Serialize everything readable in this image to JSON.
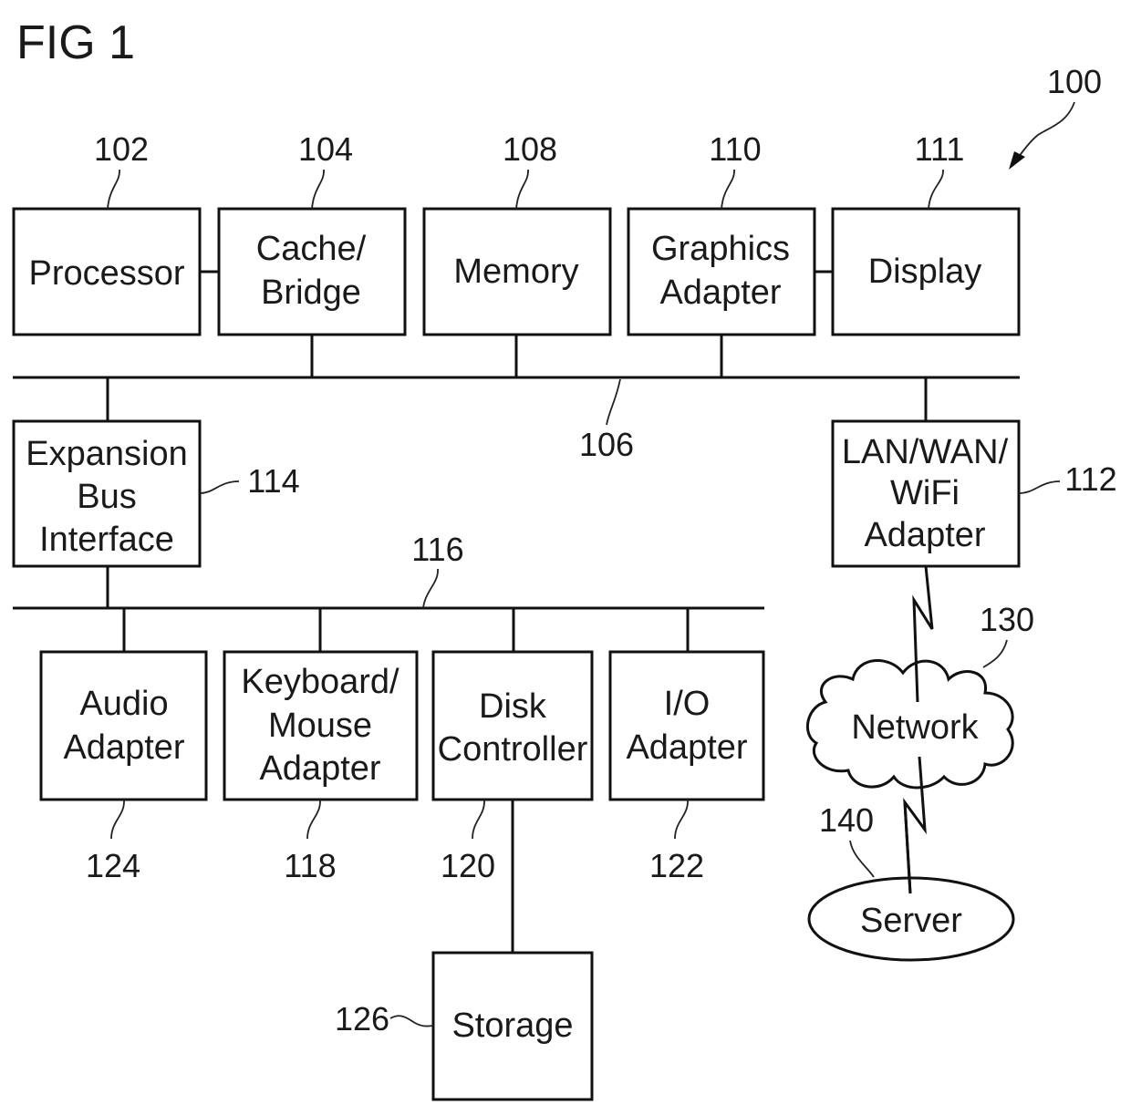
{
  "figure": {
    "title": "FIG 1",
    "system_ref": "100"
  },
  "blocks": {
    "processor": {
      "lines": [
        "Processor"
      ],
      "ref": "102"
    },
    "cache_bridge": {
      "lines": [
        "Cache/",
        "Bridge"
      ],
      "ref": "104"
    },
    "memory": {
      "lines": [
        "Memory"
      ],
      "ref": "108"
    },
    "graphics_adapter": {
      "lines": [
        "Graphics",
        "Adapter"
      ],
      "ref": "110"
    },
    "display": {
      "lines": [
        "Display"
      ],
      "ref": "111"
    },
    "expansion_bus_interface": {
      "lines": [
        "Expansion",
        "Bus",
        "Interface"
      ],
      "ref": "114"
    },
    "lan_wan_wifi_adapter": {
      "lines": [
        "LAN/WAN/",
        "WiFi",
        "Adapter"
      ],
      "ref": "112"
    },
    "audio_adapter": {
      "lines": [
        "Audio",
        "Adapter"
      ],
      "ref": "124"
    },
    "keyboard_mouse_adapter": {
      "lines": [
        "Keyboard/",
        "Mouse",
        "Adapter"
      ],
      "ref": "118"
    },
    "disk_controller": {
      "lines": [
        "Disk",
        "Controller"
      ],
      "ref": "120"
    },
    "io_adapter": {
      "lines": [
        "I/O",
        "Adapter"
      ],
      "ref": "122"
    },
    "storage": {
      "lines": [
        "Storage"
      ],
      "ref": "126"
    },
    "network": {
      "lines": [
        "Network"
      ],
      "ref": "130"
    },
    "server": {
      "lines": [
        "Server"
      ],
      "ref": "140"
    }
  },
  "buses": {
    "system_bus": {
      "ref": "106"
    },
    "expansion_bus": {
      "ref": "116"
    }
  }
}
